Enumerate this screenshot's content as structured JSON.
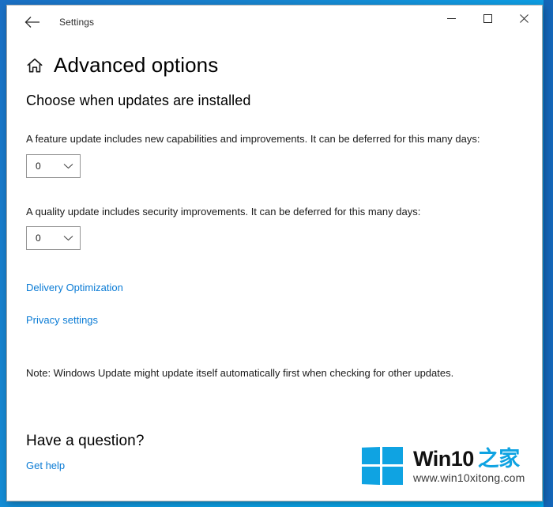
{
  "window": {
    "titlebar": {
      "title": "Settings",
      "back_icon": "back-arrow-icon",
      "minimize_label": "─",
      "maximize_label": "□",
      "close_label": "✕"
    }
  },
  "page": {
    "home_icon": "home-icon",
    "title": "Advanced options",
    "section_heading": "Choose when updates are installed",
    "feature_update": {
      "description": "A feature update includes new capabilities and improvements. It can be deferred for this many days:",
      "value": "0",
      "chevron_icon": "chevron-down-icon"
    },
    "quality_update": {
      "description": "A quality update includes security improvements. It can be deferred for this many days:",
      "value": "0",
      "chevron_icon": "chevron-down-icon"
    },
    "links": {
      "delivery_optimization": "Delivery Optimization",
      "privacy_settings": "Privacy settings"
    },
    "note": "Note: Windows Update might update itself automatically first when checking for other updates.",
    "question_heading": "Have a question?",
    "get_help": "Get help"
  },
  "watermark": {
    "logo_icon": "windows-logo-icon",
    "brand_main": "Win10",
    "brand_cn": "之家",
    "url": "www.win10xitong.com"
  },
  "colors": {
    "link": "#0a7bd5",
    "logo_blue": "#0FA3E2",
    "desktop_blue": "#1785CF",
    "accent": "#0078d7"
  }
}
